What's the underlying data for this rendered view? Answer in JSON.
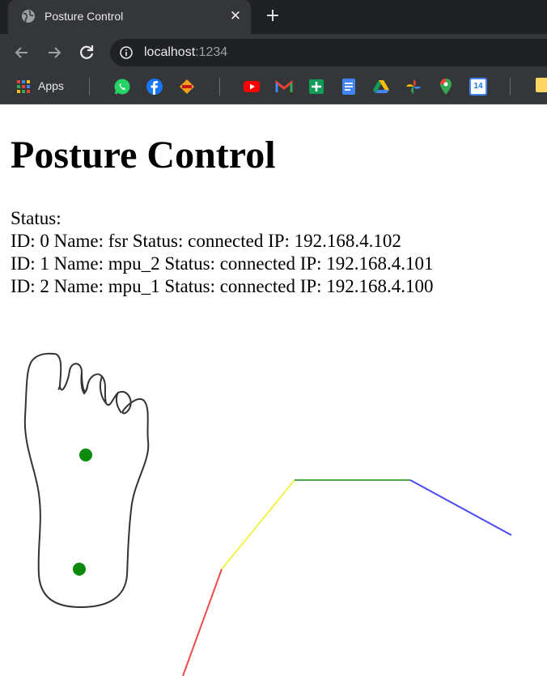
{
  "browser": {
    "tab": {
      "title": "Posture Control",
      "close_symbol": "✕"
    },
    "new_tab_symbol": "+",
    "address": {
      "host": "localhost",
      "port": ":1234"
    },
    "bookmarks": {
      "apps_label": "Apps",
      "items": [
        "whatsapp-icon",
        "facebook-icon",
        "bookmark-icon",
        "youtube-icon",
        "gmail-icon",
        "sheets-icon",
        "docs-icon",
        "drive-icon",
        "photos-icon",
        "maps-icon",
        "calendar-icon"
      ],
      "calendar_day": "14"
    }
  },
  "page": {
    "title": "Posture Control",
    "status_label": "Status:",
    "devices": [
      {
        "line": "ID: 0 Name: fsr Status: connected IP: 192.168.4.102"
      },
      {
        "line": "ID: 1 Name: mpu_2 Status: connected IP: 192.168.4.101"
      },
      {
        "line": "ID: 2 Name: mpu_1 Status: connected IP: 192.168.4.100"
      }
    ]
  },
  "colors": {
    "sensor_dot": "#0b8a0b",
    "segment_1": "#f04a4a",
    "segment_2": "#f2f24a",
    "segment_3": "#4aa84a",
    "segment_4": "#4a4af0"
  }
}
